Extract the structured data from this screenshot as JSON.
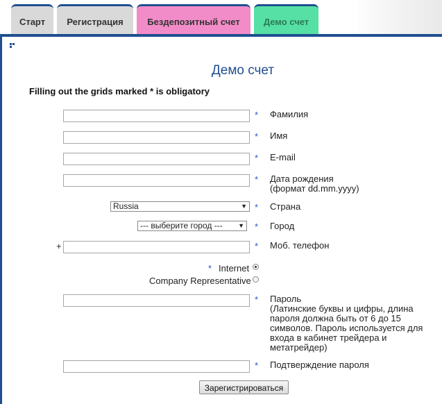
{
  "tabs": {
    "start": "Старт",
    "registration": "Регистрация",
    "no_deposit": "Бездепозитный счет",
    "demo": "Демо счет"
  },
  "form": {
    "title": "Демо счет",
    "notice": "Filling out the grids marked * is obligatory",
    "required_mark": "*",
    "surname_label": "Фамилия",
    "name_label": "Имя",
    "email_label": "E-mail",
    "birth_label_line1": "Дата рождения",
    "birth_label_line2": "(формат dd.mm.yyyy)",
    "country_label": "Страна",
    "country_value": "Russia",
    "city_label": "Город",
    "city_value": "--- выберите город ---",
    "phone_prefix": "+",
    "phone_label": "Моб. телефон",
    "radio_internet": "Internet",
    "radio_company": "Company Representative",
    "password_label_lines": [
      "Пароль",
      "(Латинские буквы и цифры, длина",
      "пароля должна быть от 6 до 15",
      "символов. Пароль используется для",
      "входа в кабинет трейдера и",
      "метатрейдер)"
    ],
    "confirm_label": "Подтверждение пароля",
    "submit_label": "Зарегистрироваться"
  },
  "icons": {
    "corner": "grid-icon",
    "dropdown": "caret-down-icon"
  },
  "colors": {
    "accent": "#1f4f8f",
    "required": "#2b56c6",
    "tab_no_deposit": "#f28cc8",
    "tab_demo": "#56e0a6"
  }
}
